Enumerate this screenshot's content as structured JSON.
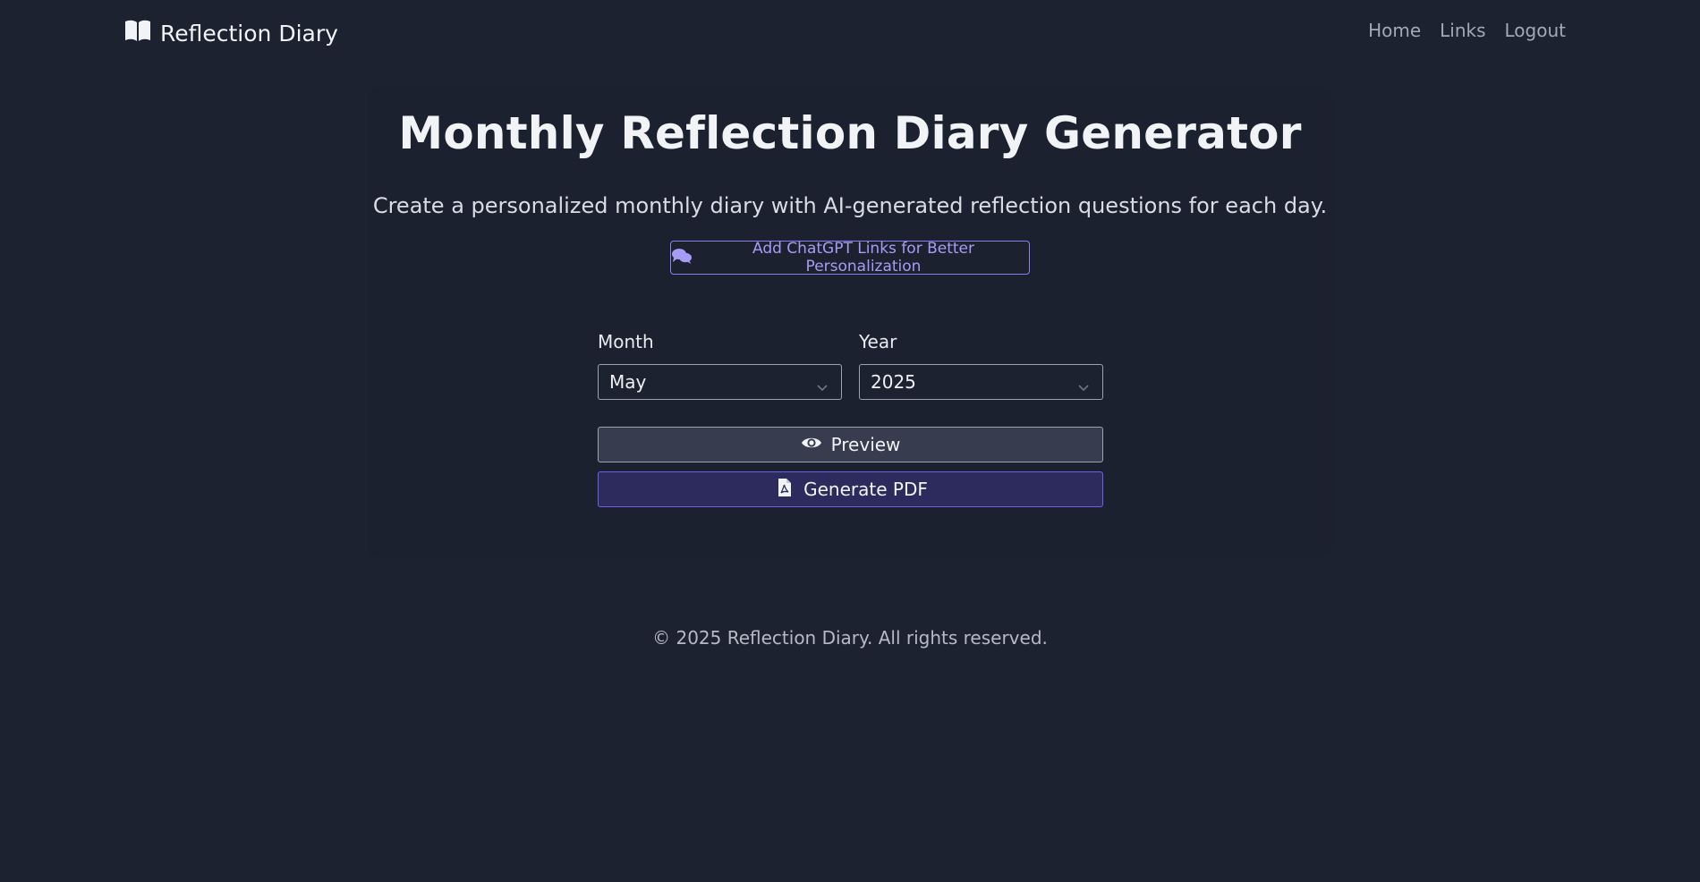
{
  "navbar": {
    "brand_icon": "open-book-icon",
    "brand": "Reflection Diary",
    "links": [
      {
        "label": "Home"
      },
      {
        "label": "Links"
      },
      {
        "label": "Logout"
      }
    ]
  },
  "main": {
    "title": "Monthly Reflection Diary Generator",
    "subtitle": "Create a personalized monthly diary with AI-generated reflection questions for each day.",
    "chatgpt_button": {
      "icon": "comments-icon",
      "label": "Add ChatGPT Links for Better Personalization"
    },
    "form": {
      "month": {
        "label": "Month",
        "value": "May"
      },
      "year": {
        "label": "Year",
        "value": "2025"
      }
    },
    "preview_button": {
      "icon": "eye-icon",
      "label": "Preview"
    },
    "pdf_button": {
      "icon": "file-pdf-icon",
      "label": "Generate PDF"
    }
  },
  "footer": {
    "text": "© 2025 Reflection Diary. All rights reserved."
  },
  "colors": {
    "background": "#1d2231",
    "accent": "#8b7ff0",
    "primary_button": "#2d2b5d",
    "secondary_button": "#373d4e"
  }
}
